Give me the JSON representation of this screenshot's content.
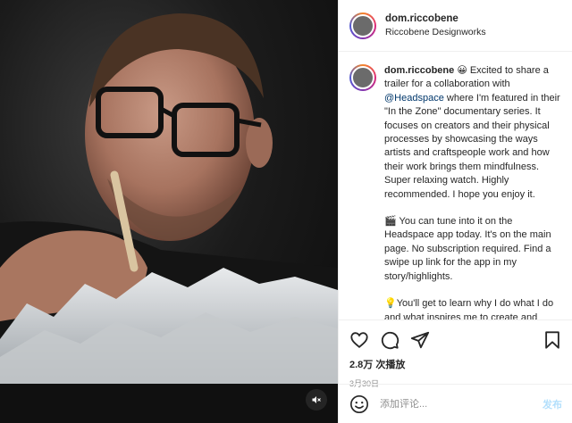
{
  "header": {
    "username": "dom.riccobene",
    "subtitle": "Riccobene Designworks"
  },
  "caption": {
    "username": "dom.riccobene",
    "emoji1": "😀",
    "text1": " Excited to share a trailer for a collaboration with ",
    "mention": "@Headspace",
    "text2": " where I'm featured in their \"In the Zone\" documentary series. It focuses on creators and their physical processes by showcasing the ways artists and craftspeople work and how their work brings them mindfulness. Super relaxing watch. Highly recommended. I hope you enjoy it.",
    "para2_emoji": "🎬",
    "para2_text": " You can tune into it on the Headspace app today. It's on the main page. No subscription required. Find a swipe up link for the app in my story/highlights.",
    "para3_emoji": "💡",
    "para3_text": "You'll get to learn why I do what I do and what inspires me to create and"
  },
  "stats": {
    "views": "2.8万 次播放",
    "date": "3月30日"
  },
  "comment": {
    "placeholder": "添加评论...",
    "post_label": "发布"
  },
  "icons": {
    "like": "heart-icon",
    "comment": "comment-icon",
    "share": "share-icon",
    "save": "bookmark-icon",
    "mute": "muted-speaker-icon",
    "emoji": "emoji-icon"
  },
  "colors": {
    "mention": "#00376b",
    "post_disabled": "#b2dffc",
    "muted_text": "#8e8e8e"
  }
}
